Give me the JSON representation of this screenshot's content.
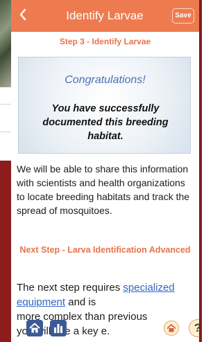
{
  "header": {
    "title": "Identify Larvae",
    "back_icon": "chevron-left-icon",
    "save_label": "Save"
  },
  "step_title": "Step 3 - Identify Larvae",
  "card": {
    "congrats": "Congratulations!",
    "message": "You have successfully documented this breeding habitat."
  },
  "share_text": "We will be able to share this information with scientists and health organizations to locate breeding habitats and track the spread of mosquitoes.",
  "next": {
    "title": "Next Step - Larva Identification Advanced",
    "text_before": "The next step requires ",
    "link_text": "specialized equipment",
    "text_line2a": " and is",
    "text_line3": "more complex than previous",
    "text_line4": "you will use a key",
    "text_line4_end": "e."
  },
  "bottom": {
    "home_icon": "home-icon",
    "chart_icon": "bar-chart-icon",
    "home_outline_icon": "home-outline-icon",
    "help_label": "?"
  },
  "colors": {
    "header": "#ee7b50",
    "accent": "#e8734a",
    "congrats_blue": "#4b6fb0",
    "link": "#2f66c4",
    "nav_blue": "#3c5a94"
  }
}
